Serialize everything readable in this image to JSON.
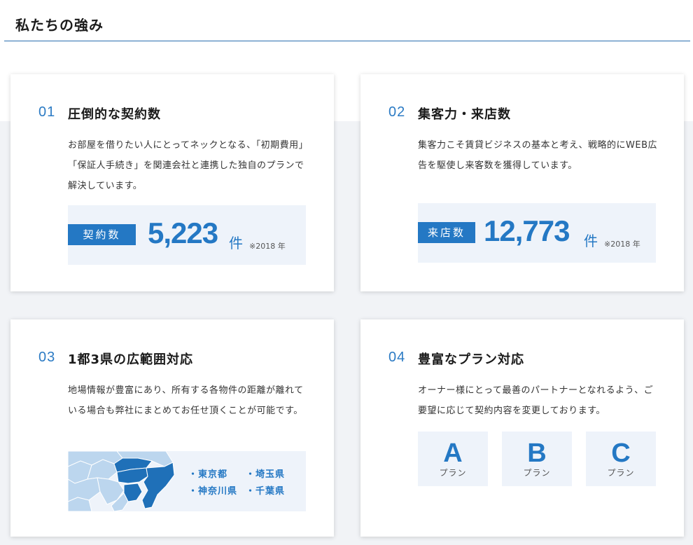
{
  "section": {
    "title": "私たちの強み"
  },
  "cards": [
    {
      "num": "01",
      "title": "圧倒的な契約数",
      "desc": "お部屋を借りたい人にとってネックとなる、「初期費用」「保証人手続き」を関連会社と連携した独自のプランで解決しています。",
      "stat": {
        "label": "契約数",
        "value": "5,223",
        "unit": "件",
        "note": "※2018 年"
      }
    },
    {
      "num": "02",
      "title": "集客力・来店数",
      "desc": "集客力こそ賃貸ビジネスの基本と考え、戦略的にWEB広告を駆使し来客数を獲得しています。",
      "stat": {
        "label": "来店数",
        "value": "12,773",
        "unit": "件",
        "note": "※2018 年"
      }
    },
    {
      "num": "03",
      "title": "1都3県の広範囲対応",
      "desc": "地場情報が豊富にあり、所有する各物件の距離が離れている場合も弊社にまとめてお任せ頂くことが可能です。",
      "prefectures": [
        "・東京都",
        "・埼玉県",
        "・神奈川県",
        "・千葉県"
      ]
    },
    {
      "num": "04",
      "title": "豊富なプラン対応",
      "desc": "オーナー様にとって最善のパートナーとなれるよう、ご要望に応じて契約内容を変更しております。",
      "plans": [
        {
          "letter": "A",
          "sub": "プラン"
        },
        {
          "letter": "B",
          "sub": "プラン"
        },
        {
          "letter": "C",
          "sub": "プラン"
        }
      ]
    }
  ],
  "colors": {
    "accent": "#2478c4",
    "tile_bg": "#eef3fa",
    "band_bg": "#f1f3f6",
    "map_light": "#bcd6ee"
  }
}
